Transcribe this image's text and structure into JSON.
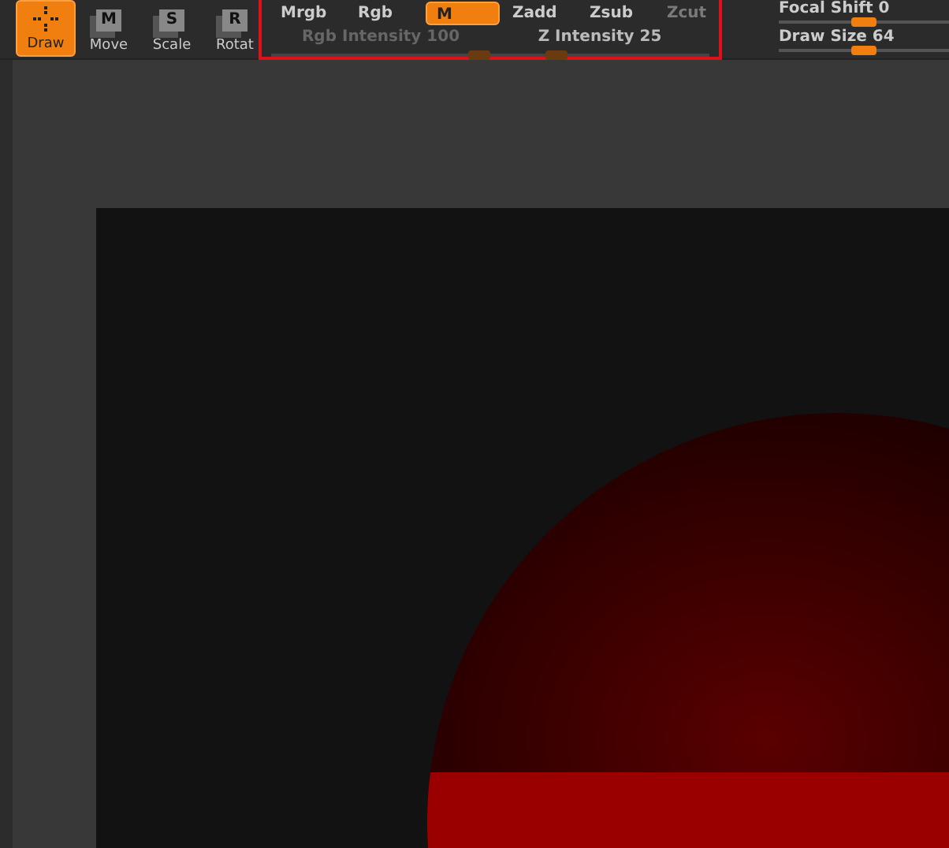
{
  "tools": [
    {
      "label": "Draw",
      "selected": true
    },
    {
      "label": "Move",
      "letter": "M",
      "selected": false
    },
    {
      "label": "Scale",
      "letter": "S",
      "selected": false
    },
    {
      "label": "Rotat",
      "letter": "R",
      "selected": false
    }
  ],
  "modes": [
    {
      "label": "Mrgb",
      "selected": false,
      "disabled": false
    },
    {
      "label": "Rgb",
      "selected": false,
      "disabled": false
    },
    {
      "label": "M",
      "selected": true,
      "disabled": false
    },
    {
      "label": "Zadd",
      "selected": false,
      "disabled": false
    },
    {
      "label": "Zsub",
      "selected": false,
      "disabled": false
    },
    {
      "label": "Zcut",
      "selected": false,
      "disabled": true
    }
  ],
  "intensity_sliders": [
    {
      "label": "Rgb Intensity",
      "value": "100",
      "disabled": true,
      "level": 0.95
    },
    {
      "label": "Z Intensity",
      "value": "25",
      "disabled": false,
      "level": 0.3
    }
  ],
  "brush_sliders": [
    {
      "label": "Focal Shift",
      "value": "0",
      "level": 0.5
    },
    {
      "label": "Draw Size",
      "value": "64",
      "level": 0.5
    }
  ]
}
